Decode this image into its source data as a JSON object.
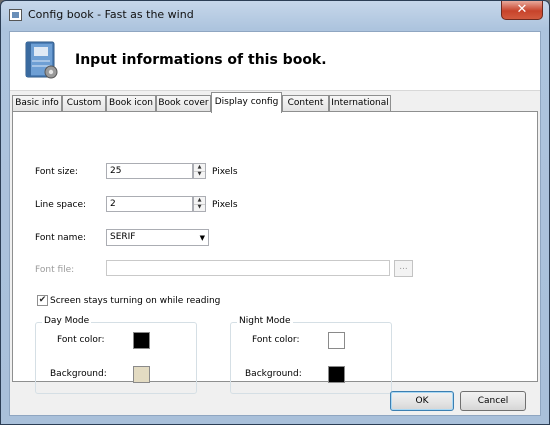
{
  "window": {
    "title": "Config book - Fast as the wind",
    "close_glyph": "✕"
  },
  "header": {
    "title": "Input informations of this book."
  },
  "tabs": [
    {
      "label": "Basic info"
    },
    {
      "label": "Custom"
    },
    {
      "label": "Book icon"
    },
    {
      "label": "Book cover"
    },
    {
      "label": "Display config"
    },
    {
      "label": "Content"
    },
    {
      "label": "International"
    }
  ],
  "display_config": {
    "font_size_label": "Font size:",
    "font_size_value": "25",
    "font_size_unit": "Pixels",
    "line_space_label": "Line space:",
    "line_space_value": "2",
    "line_space_unit": "Pixels",
    "font_name_label": "Font name:",
    "font_name_value": "SERIF",
    "font_file_label": "Font file:",
    "font_file_value": "",
    "browse_label": "...",
    "screen_on_label": "Screen stays turning on while reading",
    "screen_on_checked": "✔",
    "day_mode": {
      "title": "Day Mode",
      "font_color_label": "Font color:",
      "font_color": "#000000",
      "background_label": "Background:",
      "background": "#e3dbc2"
    },
    "night_mode": {
      "title": "Night Mode",
      "font_color_label": "Font color:",
      "font_color": "#ffffff",
      "background_label": "Background:",
      "background": "#000000"
    }
  },
  "footer": {
    "ok_label": "OK",
    "cancel_label": "Cancel"
  },
  "icons": {
    "app": "book-icon",
    "header": "book-gear-icon",
    "close": "close-icon",
    "spin_up": "▲",
    "spin_down": "▼",
    "dropdown": "▼"
  }
}
